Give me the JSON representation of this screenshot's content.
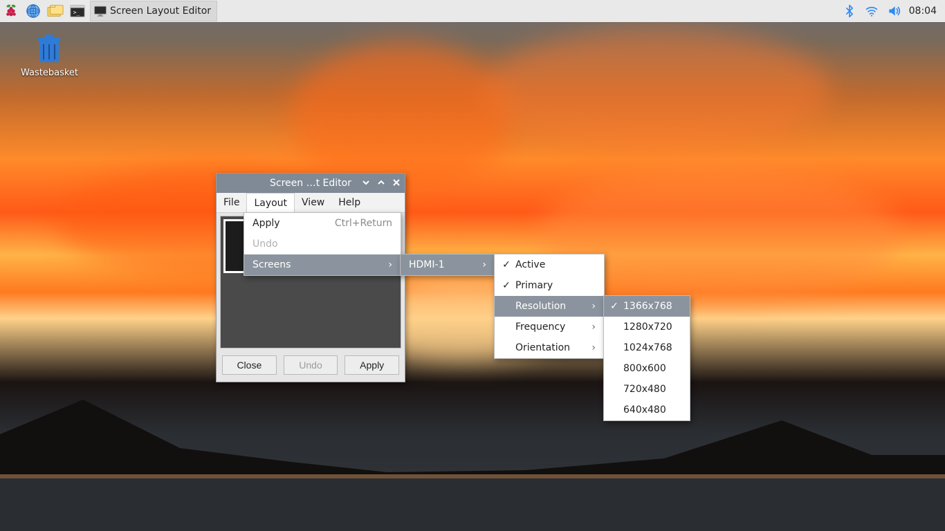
{
  "panel": {
    "taskbar_app": "Screen Layout Editor",
    "clock": "08:04"
  },
  "desktop": {
    "wastebasket_label": "Wastebasket"
  },
  "window": {
    "title": "Screen …t Editor",
    "menubar": {
      "file": "File",
      "layout": "Layout",
      "view": "View",
      "help": "Help"
    },
    "buttons": {
      "close": "Close",
      "undo": "Undo",
      "apply": "Apply"
    }
  },
  "menu_layout": {
    "apply": "Apply",
    "apply_accel": "Ctrl+Return",
    "undo": "Undo",
    "screens": "Screens"
  },
  "menu_screens": {
    "hdmi1": "HDMI-1"
  },
  "menu_hdmi": {
    "active": "Active",
    "primary": "Primary",
    "resolution": "Resolution",
    "frequency": "Frequency",
    "orientation": "Orientation"
  },
  "menu_res": {
    "r0": "1366x768",
    "r1": "1280x720",
    "r2": "1024x768",
    "r3": "800x600",
    "r4": "720x480",
    "r5": "640x480"
  }
}
